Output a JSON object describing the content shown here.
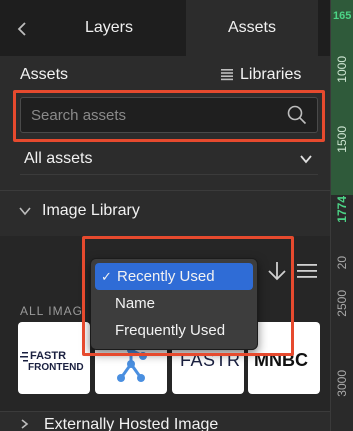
{
  "tabs": {
    "layers": "Layers",
    "assets": "Assets"
  },
  "ruler": {
    "top_number": "165",
    "labels": [
      "1000",
      "1500",
      "1774",
      "20",
      "2500",
      "3000"
    ]
  },
  "assets": {
    "title": "Assets",
    "libraries_label": "Libraries"
  },
  "search": {
    "placeholder": "Search assets",
    "value": ""
  },
  "filter": {
    "selected": "All assets"
  },
  "image_library": {
    "title": "Image Library",
    "all_images_label": "ALL IMAG"
  },
  "sort_menu": {
    "items": [
      {
        "label": "Recently Used",
        "selected": true
      },
      {
        "label": "Name",
        "selected": false
      },
      {
        "label": "Frequently Used",
        "selected": false
      }
    ],
    "check": "✓"
  },
  "thumbnails": [
    {
      "line1": "FASTR",
      "line2": "FRONTEND"
    },
    {
      "line1": "",
      "line2": ""
    },
    {
      "line1": "FASTR",
      "line2": ""
    },
    {
      "line1": "MNBC",
      "line2": ""
    }
  ],
  "next_section": {
    "title": "Externally Hosted Image"
  },
  "colors": {
    "accent_highlight": "#e64a2e",
    "selected_blue": "#2f6cd6",
    "ruler_green": "#2f5a3a"
  }
}
